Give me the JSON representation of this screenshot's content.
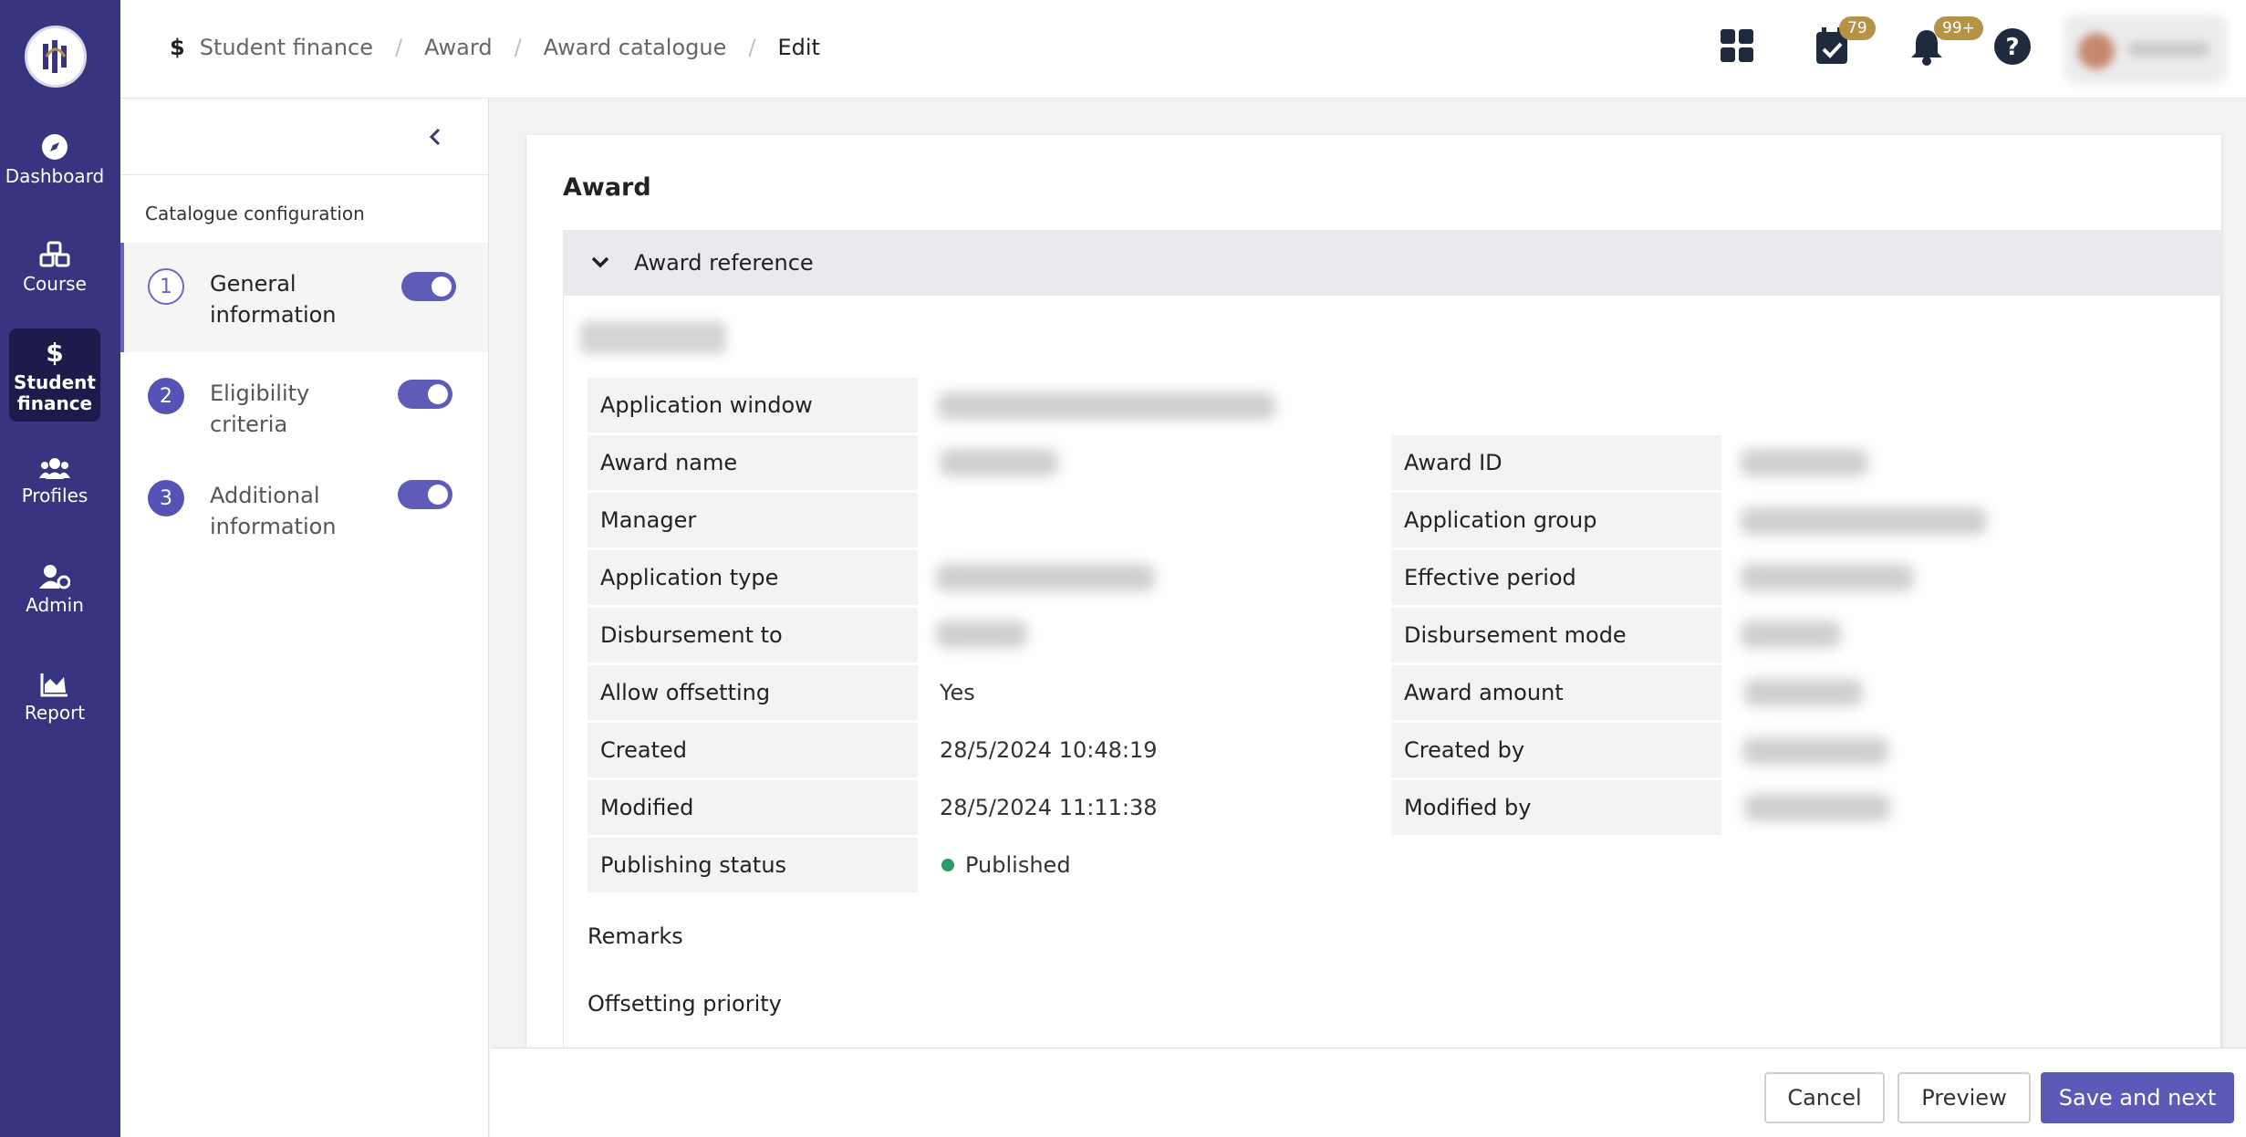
{
  "nav": {
    "items": [
      {
        "label": "Dashboard"
      },
      {
        "label": "Course"
      },
      {
        "label": "Student finance"
      },
      {
        "label": "Profiles"
      },
      {
        "label": "Admin"
      },
      {
        "label": "Report"
      }
    ]
  },
  "breadcrumb": [
    "Student finance",
    "Award",
    "Award catalogue",
    "Edit"
  ],
  "topbar": {
    "tasks_badge": "79",
    "notifications_badge": "99+"
  },
  "side": {
    "title": "Catalogue configuration",
    "steps": [
      {
        "num": "1",
        "label": "General information",
        "enabled": true
      },
      {
        "num": "2",
        "label": "Eligibility criteria",
        "enabled": true
      },
      {
        "num": "3",
        "label": "Additional information",
        "enabled": true
      }
    ]
  },
  "card": {
    "title": "Award",
    "section_title": "Award reference",
    "left_fields": [
      {
        "label": "Application window"
      },
      {
        "label": "Award name"
      },
      {
        "label": "Manager"
      },
      {
        "label": "Application type"
      },
      {
        "label": "Disbursement to"
      },
      {
        "label": "Allow offsetting",
        "value": "Yes"
      },
      {
        "label": "Created",
        "value": "28/5/2024 10:48:19"
      },
      {
        "label": "Modified",
        "value": "28/5/2024 11:11:38"
      },
      {
        "label": "Publishing status",
        "value": "Published"
      }
    ],
    "right_fields": [
      {
        "label": "Award ID"
      },
      {
        "label": "Application group"
      },
      {
        "label": "Effective period"
      },
      {
        "label": "Disbursement mode"
      },
      {
        "label": "Award amount"
      },
      {
        "label": "Created by"
      },
      {
        "label": "Modified by"
      }
    ],
    "remarks_label": "Remarks",
    "offsetting_label": "Offsetting priority"
  },
  "footer": {
    "cancel": "Cancel",
    "preview": "Preview",
    "save_next": "Save and next"
  },
  "colors": {
    "nav_bg": "#37357f",
    "accent": "#5b5ab8",
    "badge": "#b59245",
    "published": "#2e9b6b"
  }
}
